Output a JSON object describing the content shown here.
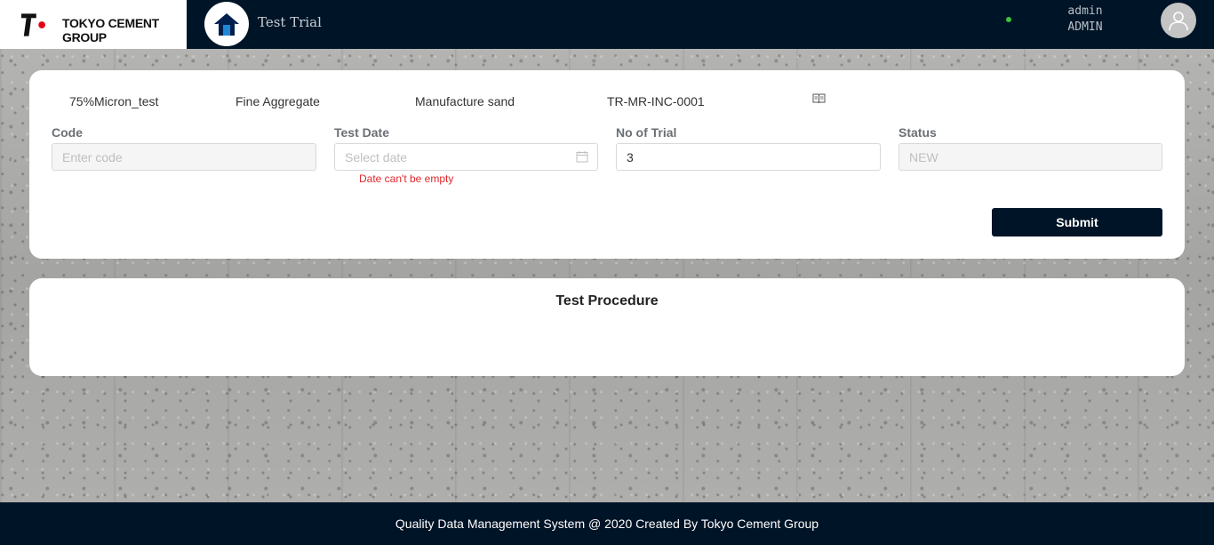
{
  "header": {
    "brand": "TOKYO CEMENT GROUP",
    "page_title": "Test Trial",
    "user": {
      "name": "admin",
      "role": "ADMIN"
    },
    "icons": {
      "home": "home-icon",
      "avatar": "user-icon"
    },
    "colors": {
      "nav_bg": "#001427",
      "online": "#3fbf3f"
    }
  },
  "info": {
    "test_name": "75%Micron_test",
    "material": "Fine Aggregate",
    "sub_material": "Manufacture sand",
    "trial_code": "TR-MR-INC-0001",
    "book_icon": "book-icon"
  },
  "form": {
    "code": {
      "label": "Code",
      "placeholder": "Enter code",
      "value": ""
    },
    "test_date": {
      "label": "Test Date",
      "placeholder": "Select date",
      "value": "",
      "error": "Date can't be empty"
    },
    "no_of_trial": {
      "label": "No of Trial",
      "value": "3"
    },
    "status": {
      "label": "Status",
      "placeholder": "NEW",
      "value": ""
    },
    "submit_label": "Submit"
  },
  "procedure": {
    "title": "Test Procedure"
  },
  "footer": {
    "text": "Quality Data Management System @ 2020 Created By Tokyo Cement Group"
  }
}
